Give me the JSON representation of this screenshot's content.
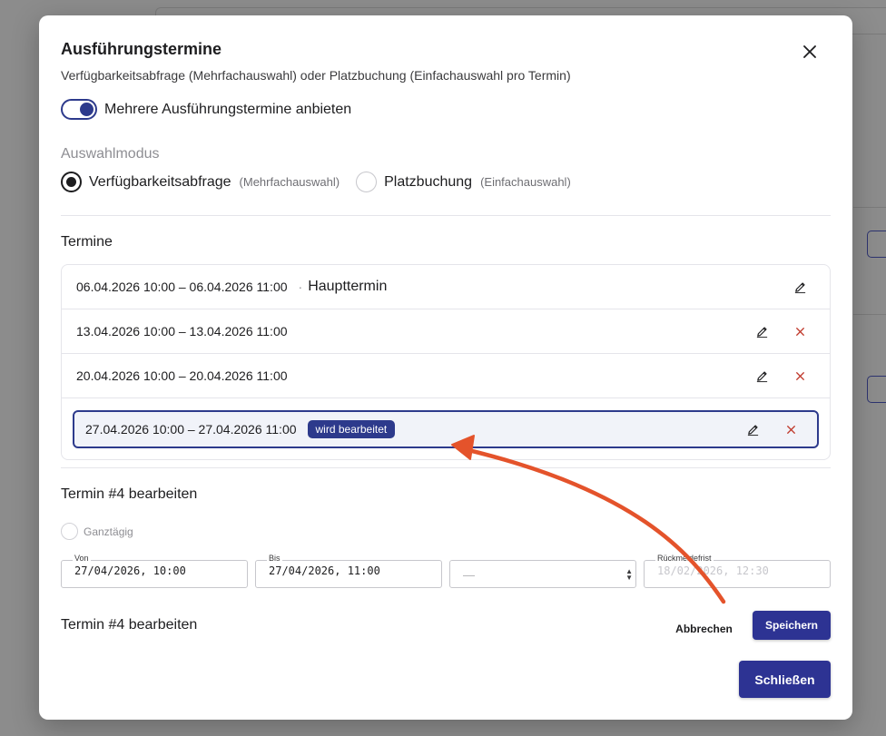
{
  "dialog": {
    "title": "Ausführungstermine",
    "subtitle": "Verfügbarkeitsabfrage (Mehrfachauswahl) oder Platzbuchung (Einfachauswahl pro Termin)",
    "close_icon": "close-icon"
  },
  "toggle": {
    "label": "Mehrere Ausführungstermine anbieten",
    "enabled": true
  },
  "selection_mode": {
    "label": "Auswahlmodus",
    "options": [
      {
        "label": "Verfügbarkeitsabfrage",
        "hint": "(Mehrfachauswahl)",
        "selected": true
      },
      {
        "label": "Platzbuchung",
        "hint": "(Einfachauswahl)",
        "selected": false
      }
    ]
  },
  "appointments": {
    "title": "Termine",
    "items": [
      {
        "range": "06.04.2026 10:00 – 06.04.2026 11:00",
        "separator": "·",
        "tag": "Haupttermin"
      },
      {
        "range": "13.04.2026 10:00 – 13.04.2026 11:00"
      },
      {
        "range": "20.04.2026 10:00 – 20.04.2026 11:00"
      },
      {
        "range": "27.04.2026 10:00 – 27.04.2026 11:00",
        "badge": "wird bearbeitet",
        "active": true
      }
    ],
    "edit_icon": "edit-icon",
    "delete_icon": "delete-icon"
  },
  "editor": {
    "title": "Termin #4 bearbeiten",
    "all_day_label": "Ganztägig",
    "from": {
      "label": "Von",
      "value": "27/04/2026, 10:00"
    },
    "to": {
      "label": "Bis",
      "value": "27/04/2026, 11:00"
    },
    "select": {
      "value": "—"
    },
    "deadline": {
      "label": "Rückmeldefrist",
      "value": "18/02/2026, 12:30"
    }
  },
  "footer": {
    "title": "Termin #4 bearbeiten",
    "cancel_label": "Abbrechen",
    "save_label": "Speichern",
    "close_label": "Schließen"
  },
  "colors": {
    "accent": "#2d3a8c",
    "delete": "#c0392b",
    "annotation_arrow": "#e4532b"
  }
}
